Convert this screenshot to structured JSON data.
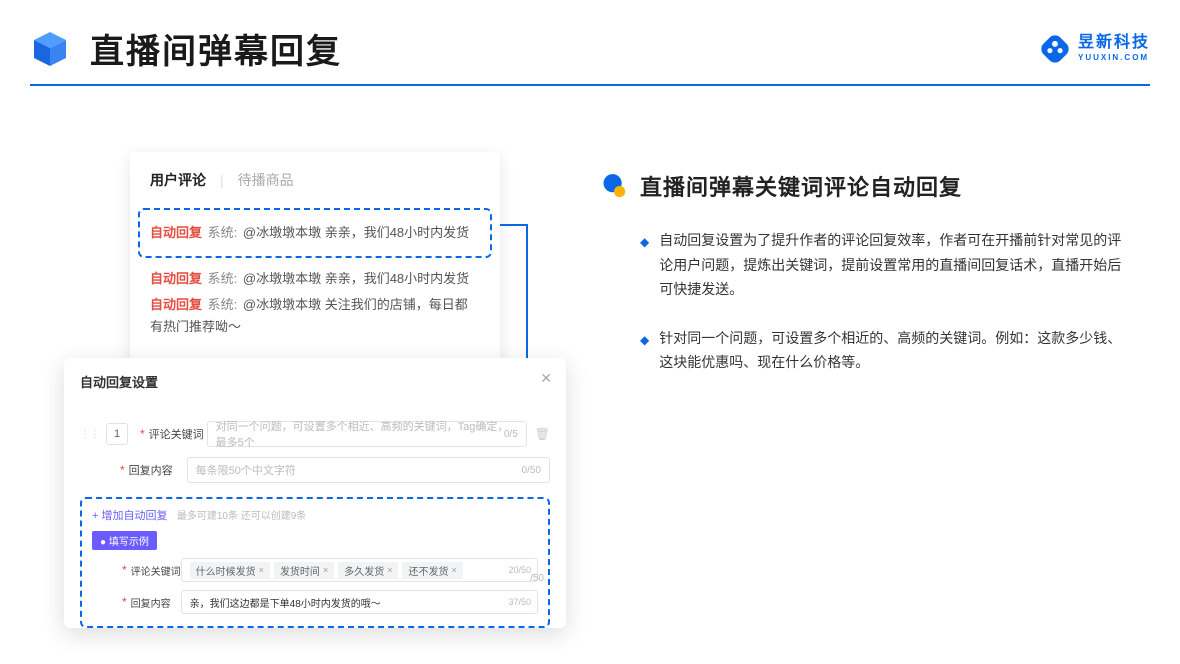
{
  "header": {
    "title": "直播间弹幕回复"
  },
  "brand": {
    "name_cn": "昱新科技",
    "name_en": "YUUXIN.COM"
  },
  "comments_card": {
    "tab_active": "用户评论",
    "tab_other": "待播商品",
    "highlighted": {
      "tag": "自动回复",
      "sys": "系统:",
      "text": "@冰墩墩本墩 亲亲，我们48小时内发货"
    },
    "lines": [
      {
        "tag": "自动回复",
        "sys": "系统:",
        "text": "@冰墩墩本墩 亲亲，我们48小时内发货"
      },
      {
        "tag": "自动回复",
        "sys": "系统:",
        "text": "@冰墩墩本墩 关注我们的店铺，每日都有热门推荐呦～"
      }
    ]
  },
  "modal": {
    "title": "自动回复设置",
    "index": "1",
    "keyword": {
      "label": "评论关键词",
      "placeholder": "对同一个问题，可设置多个相近、高频的关键词，Tag确定，最多5个",
      "count": "0/5"
    },
    "reply": {
      "label": "回复内容",
      "placeholder": "每条限50个中文字符",
      "count": "0/50"
    },
    "add_link": "+ 增加自动回复",
    "add_hint": "最多可建10条 还可以创建9条",
    "example_badge": "● 填写示例",
    "example_keyword": {
      "label": "评论关键词",
      "tags": [
        "什么时候发货",
        "发货时间",
        "多久发货",
        "还不发货"
      ],
      "count": "20/50"
    },
    "example_reply": {
      "label": "回复内容",
      "text": "亲，我们这边都是下单48小时内发货的哦～",
      "count": "37/50"
    },
    "bottom_count": "/50"
  },
  "right": {
    "section_title": "直播间弹幕关键词评论自动回复",
    "bullets": [
      "自动回复设置为了提升作者的评论回复效率，作者可在开播前针对常见的评论用户问题，提炼出关键词，提前设置常用的直播间回复话术，直播开始后可快捷发送。",
      "针对同一个问题，可设置多个相近的、高频的关键词。例如：这款多少钱、这块能优惠吗、现在什么价格等。"
    ]
  }
}
